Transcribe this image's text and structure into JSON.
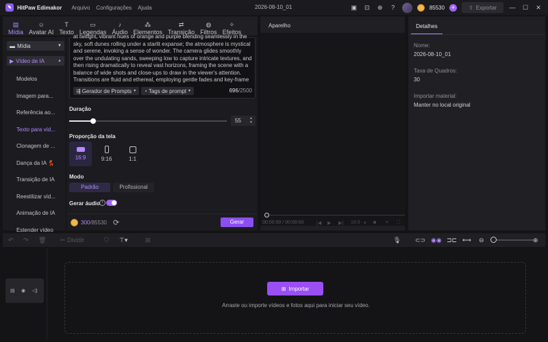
{
  "app": {
    "name": "HitPaw Edimakor",
    "menu": [
      "Arquivo",
      "Configurações",
      "Ajuda"
    ],
    "project": "2026-08-10_01",
    "credits": "85530",
    "export_label": "Exportar"
  },
  "toolbar": [
    {
      "label": "Mídia",
      "icon": "media-icon",
      "active": true
    },
    {
      "label": "Avatar AI",
      "icon": "avatar-ai-icon"
    },
    {
      "label": "Texto",
      "icon": "text-icon"
    },
    {
      "label": "Legendas",
      "icon": "subtitles-icon"
    },
    {
      "label": "Áudio",
      "icon": "audio-icon"
    },
    {
      "label": "Elementos",
      "icon": "elements-icon"
    },
    {
      "label": "Transição",
      "icon": "transition-icon"
    },
    {
      "label": "Filtros",
      "icon": "filters-icon"
    },
    {
      "label": "Efeitos",
      "icon": "effects-icon"
    }
  ],
  "sidebar": {
    "media": "Mídia",
    "video_ia": "Vídeo de IA",
    "items": [
      "Modelos",
      "Imagem para...",
      "Referência ao...",
      "Texto para víd...",
      "Clonagem de ...",
      "Dança da IA 💃",
      "Transição de IA",
      "Reestilizar víd...",
      "Animação de IA",
      "Estender vídeo"
    ]
  },
  "prompt": {
    "text": "at twilight, vibrant hues of orange and purple blending seamlessly in the sky, soft dunes rolling under a starlit expanse; the atmosphere is mystical and serene, invoking a sense of wonder. The camera glides smoothly over the undulating sands, sweeping low to capture intricate textures, and then rising dramatically to reveal vast horizons, framing the scene with a balance of wide shots and close-ups to draw in the viewer's attention. Transitions are fluid and ethereal, employing gentle fades and key-frame movements that",
    "generator": "Gerador de Prompts",
    "tags": "Tags de prompt",
    "count": "696",
    "max": "/2500"
  },
  "duration": {
    "label": "Duração",
    "value": "55",
    "fraction": 0.15
  },
  "aspect": {
    "label": "Proporção da tela",
    "options": [
      "16:9",
      "9:16",
      "1:1"
    ],
    "selected": "16:9"
  },
  "mode": {
    "label": "Modo",
    "options": [
      "Padrão",
      "Profissional"
    ],
    "selected": "Padrão"
  },
  "audio": {
    "label": "Gerar áudio",
    "on": true
  },
  "footer": {
    "cost": "300",
    "total": "/85530",
    "generate": "Gerar"
  },
  "player": {
    "title": "Aparelho",
    "time": "00:00:00 / 00:00:00",
    "ratio": "16:9"
  },
  "details": {
    "tab": "Detalhes",
    "fields": [
      {
        "key": "Nome:",
        "value": "2026-08-10_01"
      },
      {
        "key": "Taxa de Quadros:",
        "value": "30"
      },
      {
        "key": "Importar material:",
        "value": "Manter no local original"
      }
    ]
  },
  "timeline": {
    "split": "Dividir",
    "import": "Importar",
    "hint": "Arraste ou importe vídeos e fotos aqui para iniciar seu vídeo."
  }
}
